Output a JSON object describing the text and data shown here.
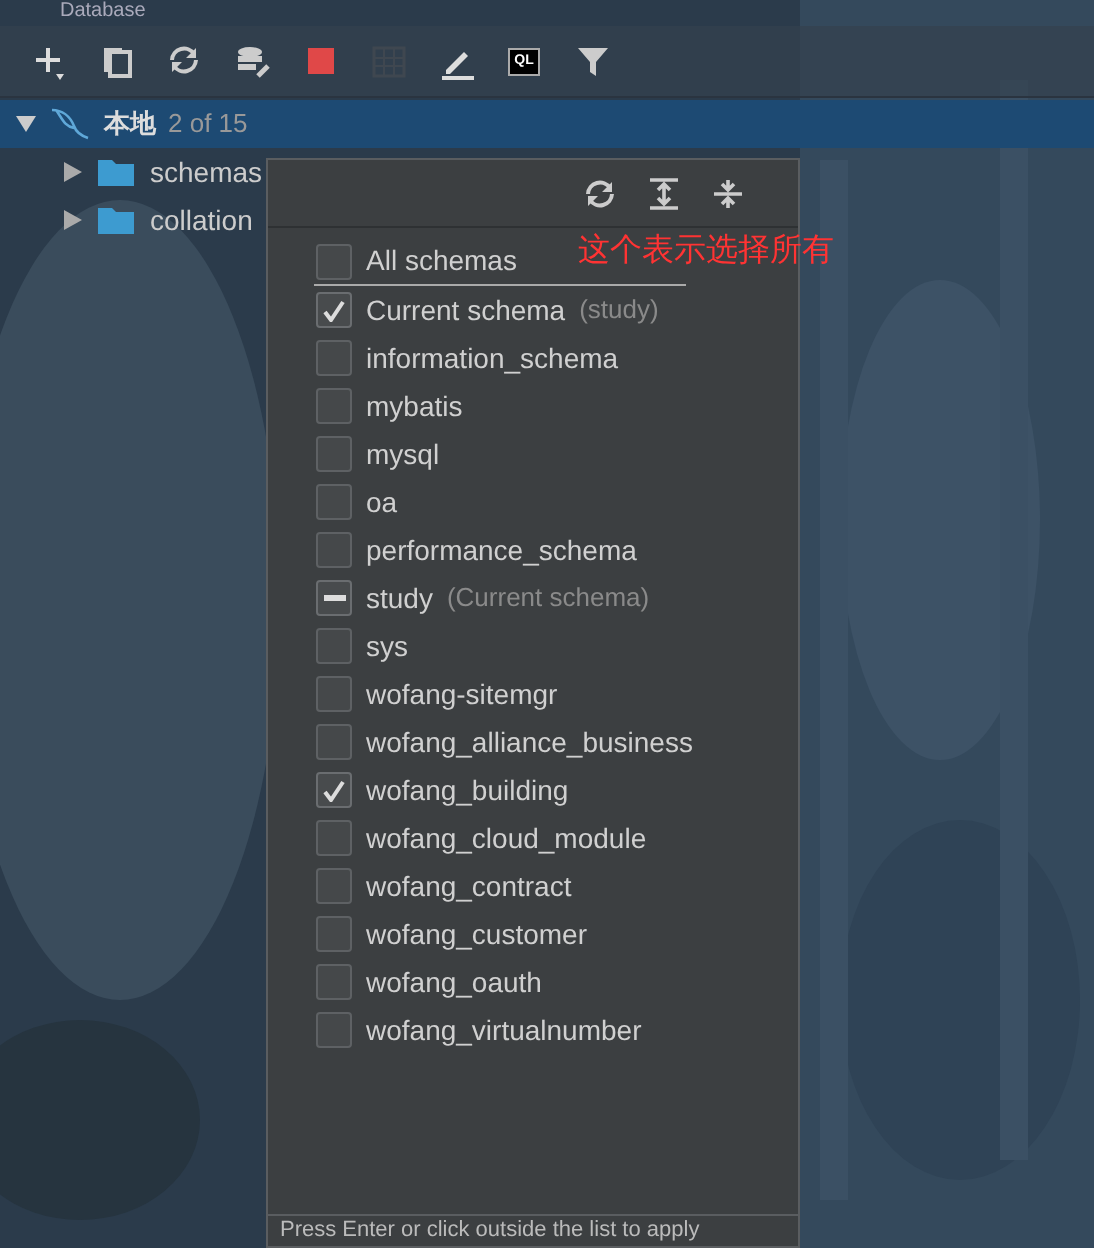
{
  "window": {
    "title": "Database"
  },
  "toolbar": {
    "buttons": [
      {
        "kind": "add"
      },
      {
        "kind": "copy"
      },
      {
        "kind": "refresh"
      },
      {
        "kind": "tools"
      },
      {
        "kind": "stop"
      },
      {
        "kind": "grid",
        "disabled": true
      },
      {
        "kind": "edit"
      },
      {
        "kind": "console",
        "label": "QL"
      },
      {
        "kind": "filter"
      }
    ]
  },
  "tree": {
    "root": {
      "label": "本地",
      "count": "2 of 15",
      "expanded": true,
      "selected": true
    },
    "children": [
      {
        "label": "schemas",
        "expanded": false,
        "selected": false
      },
      {
        "label": "collation",
        "expanded": false,
        "selected": false
      }
    ]
  },
  "popup": {
    "items": [
      {
        "label": "All schemas",
        "checked": false,
        "kind": "all"
      },
      {
        "label": "Current schema",
        "note": "(study)",
        "checked": true,
        "kind": "schema"
      },
      {
        "label": "information_schema",
        "checked": false,
        "kind": "schema"
      },
      {
        "label": "mybatis",
        "checked": false,
        "kind": "schema"
      },
      {
        "label": "mysql",
        "checked": false,
        "kind": "schema"
      },
      {
        "label": "oa",
        "checked": false,
        "kind": "schema"
      },
      {
        "label": "performance_schema",
        "checked": false,
        "kind": "schema"
      },
      {
        "label": "study",
        "note": "(Current schema)",
        "checked": true,
        "kind": "partial"
      },
      {
        "label": "sys",
        "checked": false,
        "kind": "schema"
      },
      {
        "label": "wofang-sitemgr",
        "checked": false,
        "kind": "schema"
      },
      {
        "label": "wofang_alliance_business",
        "checked": false,
        "kind": "schema"
      },
      {
        "label": "wofang_building",
        "checked": true,
        "kind": "schema"
      },
      {
        "label": "wofang_cloud_module",
        "checked": false,
        "kind": "schema"
      },
      {
        "label": "wofang_contract",
        "checked": false,
        "kind": "schema"
      },
      {
        "label": "wofang_customer",
        "checked": false,
        "kind": "schema"
      },
      {
        "label": "wofang_oauth",
        "checked": false,
        "kind": "schema"
      },
      {
        "label": "wofang_virtualnumber",
        "checked": false,
        "kind": "schema"
      }
    ],
    "footer": "Press Enter or click outside the list to apply"
  },
  "annotation": "这个表示选择所有"
}
